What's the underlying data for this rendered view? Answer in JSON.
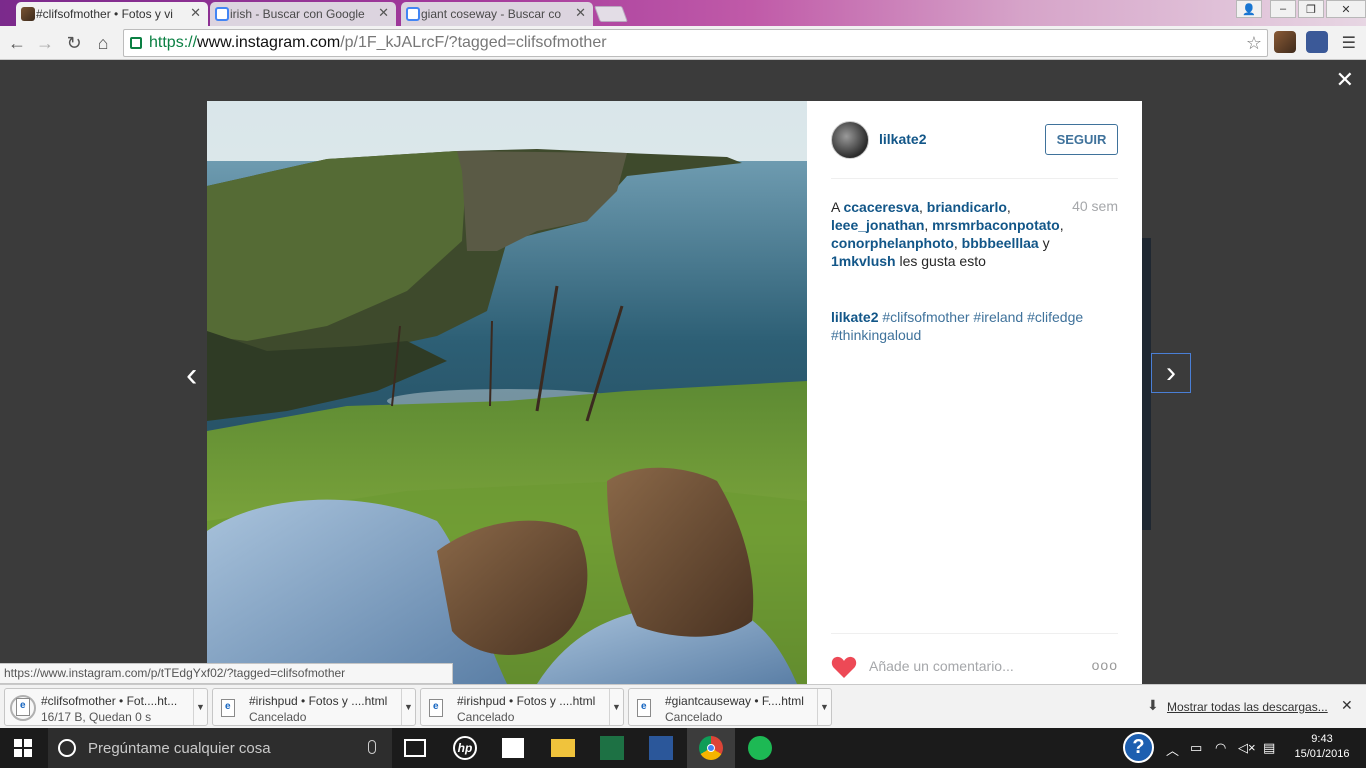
{
  "browser": {
    "tabs": [
      {
        "label": "#clifsofmother • Fotos y vi",
        "active": true
      },
      {
        "label": "irish - Buscar con Google",
        "active": false
      },
      {
        "label": "giant coseway - Buscar co",
        "active": false
      }
    ],
    "url_https": "https://",
    "url_host": "www.instagram.com",
    "url_path": "/p/1F_kJALrcF/?tagged=clifsofmother",
    "status_url": "https://www.instagram.com/p/tTEdgYxf02/?tagged=clifsofmother"
  },
  "post": {
    "username": "lilkate2",
    "follow_label": "SEGUIR",
    "time_ago": "40 sem",
    "likes_prefix": "A",
    "likers": [
      "ccaceresva",
      "briandicarlo",
      "leee_jonathan",
      "mrsmrbaconpotato",
      "conorphelanphoto",
      "bbbbeelllaa",
      "1mkvlush"
    ],
    "likes_and": "y",
    "likes_suffix": "les gusta esto",
    "caption_user": "lilkate2",
    "hashtags": "#clifsofmother #ireland #clifedge #thinkingaloud",
    "comment_placeholder": "Añade un comentario...",
    "more_label": "ooo"
  },
  "downloads": {
    "items": [
      {
        "name": "#clifsofmother • Fot....ht...",
        "status": "16/17 B, Quedan 0 s"
      },
      {
        "name": "#irishpud • Fotos y ....html",
        "status": "Cancelado"
      },
      {
        "name": "#irishpud • Fotos y ....html",
        "status": "Cancelado"
      },
      {
        "name": "#giantcauseway • F....html",
        "status": "Cancelado"
      }
    ],
    "show_all": "Mostrar todas las descargas..."
  },
  "taskbar": {
    "search_placeholder": "Pregúntame cualquier cosa",
    "time": "9:43",
    "date": "15/01/2016"
  },
  "colors": {
    "accent_link": "#125688",
    "follow_border": "#3f729b",
    "heart": "#ed4956",
    "secure_green": "#0b8043"
  }
}
